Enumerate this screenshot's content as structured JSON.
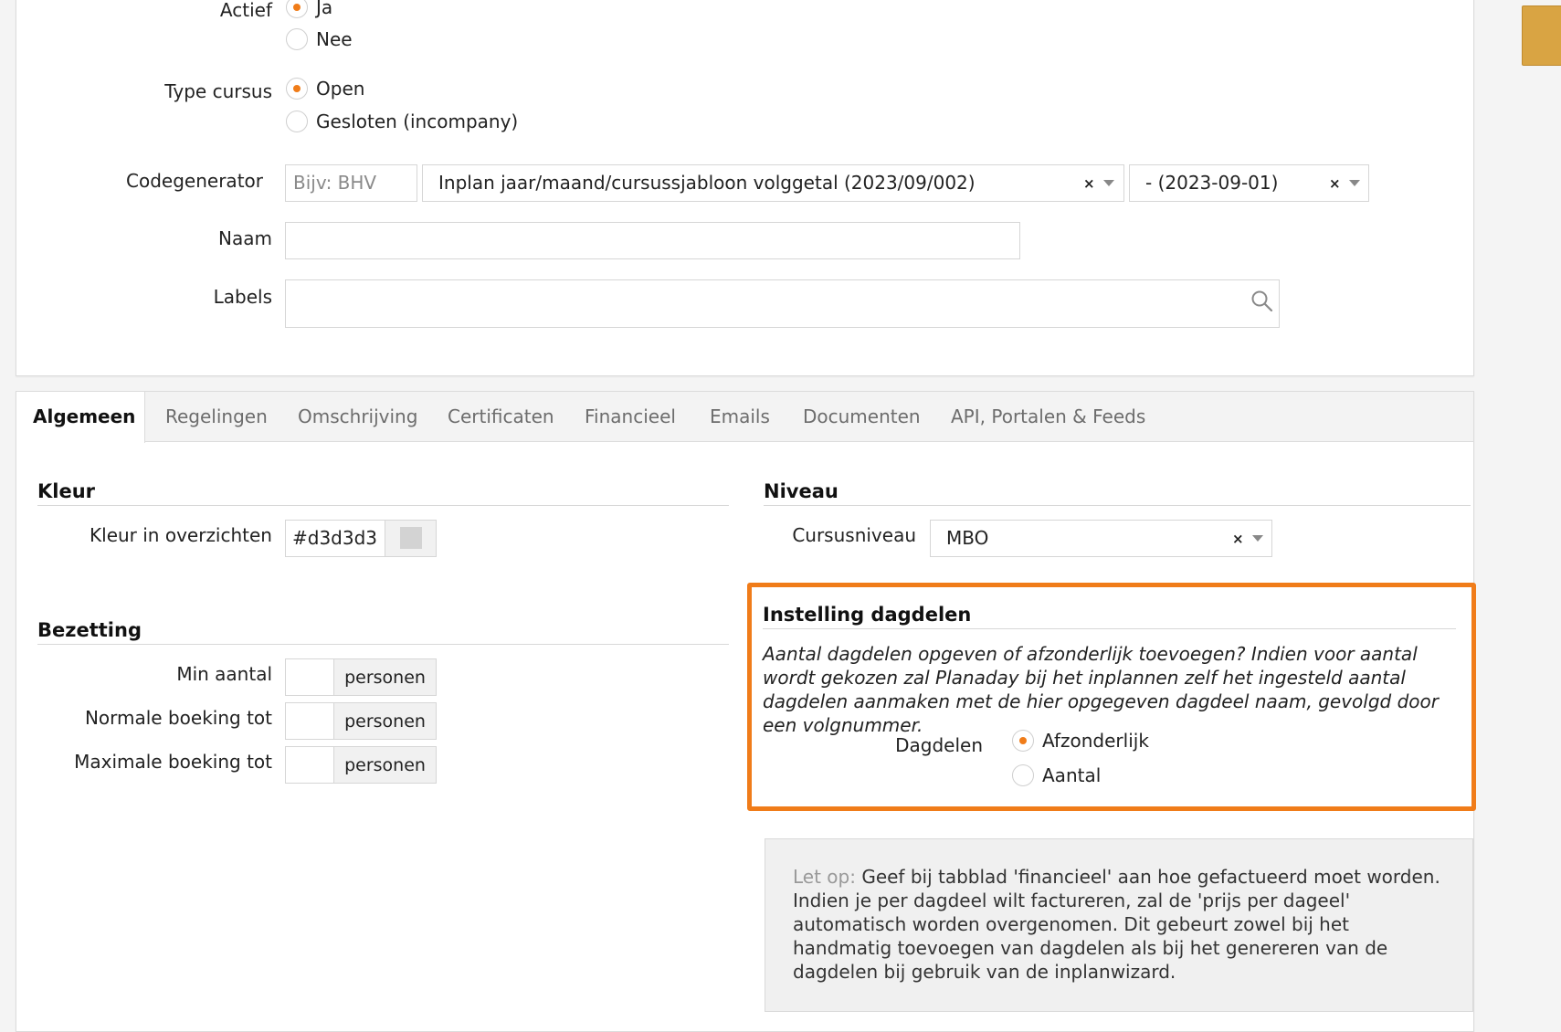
{
  "form": {
    "actief": {
      "label": "Actief",
      "options": [
        {
          "label": "Ja",
          "selected": true
        },
        {
          "label": "Nee",
          "selected": false
        }
      ]
    },
    "type_cursus": {
      "label": "Type cursus",
      "options": [
        {
          "label": "Open",
          "selected": true
        },
        {
          "label": "Gesloten (incompany)",
          "selected": false
        }
      ]
    },
    "codegenerator": {
      "label": "Codegenerator",
      "prefix_placeholder": "Bijv: BHV",
      "pattern_value": "Inplan jaar/maand/cursussjabloon volggetal (2023/09/002)",
      "date_value": "- (2023-09-01)"
    },
    "naam": {
      "label": "Naam",
      "value": ""
    },
    "labels": {
      "label": "Labels",
      "value": ""
    }
  },
  "tabs": [
    {
      "label": "Algemeen",
      "active": true
    },
    {
      "label": "Regelingen"
    },
    {
      "label": "Omschrijving"
    },
    {
      "label": "Certificaten"
    },
    {
      "label": "Financieel"
    },
    {
      "label": "Emails"
    },
    {
      "label": "Documenten"
    },
    {
      "label": "API, Portalen & Feeds"
    }
  ],
  "kleur": {
    "title": "Kleur",
    "field_label": "Kleur in overzichten",
    "value": "#d3d3d3",
    "swatch_color": "#d3d3d3"
  },
  "bezetting": {
    "title": "Bezetting",
    "rows": [
      {
        "label": "Min aantal",
        "value": "",
        "unit": "personen"
      },
      {
        "label": "Normale boeking tot",
        "value": "",
        "unit": "personen"
      },
      {
        "label": "Maximale boeking tot",
        "value": "",
        "unit": "personen"
      }
    ]
  },
  "niveau": {
    "title": "Niveau",
    "field_label": "Cursusniveau",
    "value": "MBO"
  },
  "dagdelen": {
    "title": "Instelling dagdelen",
    "description": "Aantal dagdelen opgeven of afzonderlijk toevoegen? Indien voor aantal wordt gekozen zal Planaday bij het inplannen zelf het ingesteld aantal dagdelen aanmaken met de hier opgegeven dagdeel naam, gevolgd door een volgnummer.",
    "label": "Dagdelen",
    "options": [
      {
        "label": "Afzonderlijk",
        "selected": true
      },
      {
        "label": "Aantal",
        "selected": false
      }
    ]
  },
  "info": {
    "strong": "Let op:",
    "text": " Geef bij tabblad 'financieel' aan hoe gefactueerd moet worden. Indien je per dagdeel wilt factureren, zal de 'prijs per dageel' automatisch worden overgenomen. Dit gebeurt zowel bij het handmatig toevoegen van dagdelen als bij het genereren van de dagdelen bij gebruik van de inplanwizard."
  },
  "icons": {
    "clear": "×",
    "search": "search-icon",
    "dropdown": "chevron-down-icon"
  },
  "colors": {
    "accent": "#f07c19",
    "corner_button": "#d9a443"
  }
}
